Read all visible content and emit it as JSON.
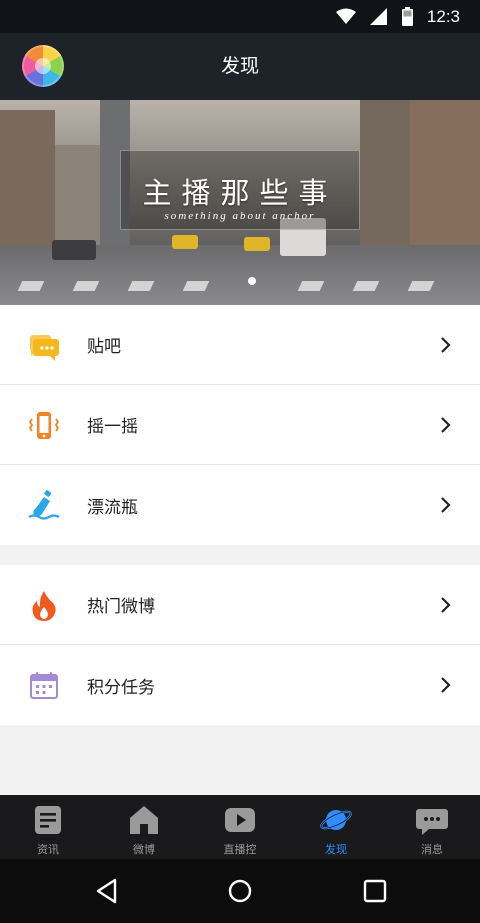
{
  "status_bar": {
    "time": "12:3"
  },
  "header": {
    "title": "发现"
  },
  "banner": {
    "title": "主播那些事",
    "subtitle": "something about anchor"
  },
  "menu_groups": [
    {
      "items": [
        {
          "label": "贴吧",
          "icon": "chat-bubble-icon",
          "color": "#f5b81c"
        },
        {
          "label": "摇一摇",
          "icon": "shake-phone-icon",
          "color": "#f58220"
        },
        {
          "label": "漂流瓶",
          "icon": "drift-bottle-icon",
          "color": "#2aa7e8"
        }
      ]
    },
    {
      "items": [
        {
          "label": "热门微博",
          "icon": "fire-icon",
          "color": "#f25a1d"
        },
        {
          "label": "积分任务",
          "icon": "calendar-icon",
          "color": "#a48ad6"
        }
      ]
    }
  ],
  "bottom_nav": [
    {
      "label": "资讯",
      "icon": "news-icon",
      "active": false
    },
    {
      "label": "微博",
      "icon": "home-icon",
      "active": false
    },
    {
      "label": "直播控",
      "icon": "play-icon",
      "active": false
    },
    {
      "label": "发现",
      "icon": "planet-icon",
      "active": true
    },
    {
      "label": "消息",
      "icon": "message-icon",
      "active": false
    }
  ],
  "colors": {
    "accent": "#2f8cff",
    "header_bg": "#1e2229",
    "nav_bg": "#1a1a1c"
  }
}
